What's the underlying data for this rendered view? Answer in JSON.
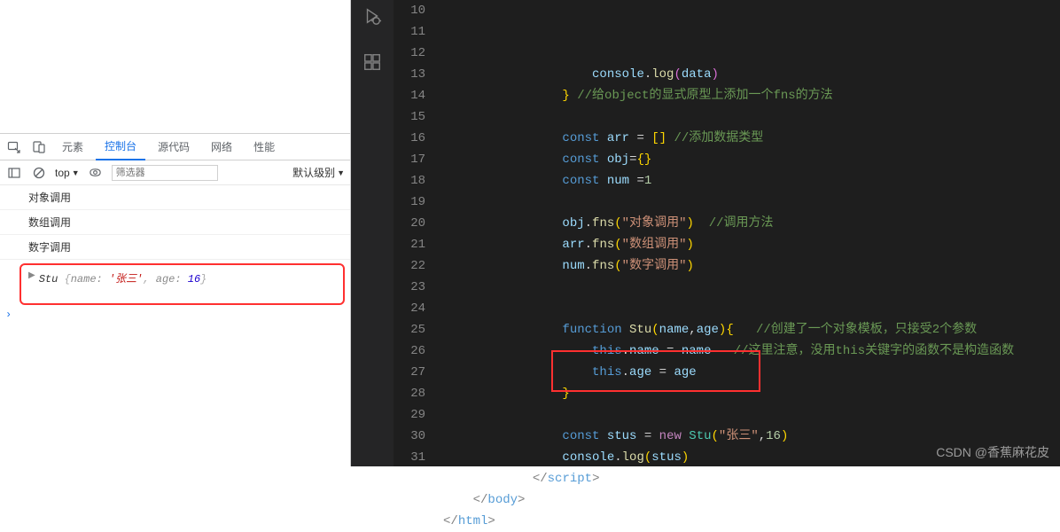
{
  "devtools": {
    "tabs": {
      "elements": "元素",
      "console": "控制台",
      "sources": "源代码",
      "network": "网络",
      "performance": "性能"
    },
    "toolbar": {
      "context": "top",
      "eye_icon": "eye-icon",
      "filter_placeholder": "筛选器",
      "level": "默认级别"
    },
    "console_logs": [
      "对象调用",
      "数组调用",
      "数字调用"
    ],
    "object_log": {
      "class": "Stu",
      "name_key": "name:",
      "name_val": "'张三'",
      "age_key": "age:",
      "age_val": "16"
    }
  },
  "editor": {
    "line_start": 10,
    "line_end": 31,
    "lines": {
      "10": [
        {
          "t": "                    ",
          "c": ""
        },
        {
          "t": "console",
          "c": "var"
        },
        {
          "t": ".",
          "c": "op"
        },
        {
          "t": "log",
          "c": "fn"
        },
        {
          "t": "(",
          "c": "brk2"
        },
        {
          "t": "data",
          "c": "var"
        },
        {
          "t": ")",
          "c": "brk2"
        }
      ],
      "11": [
        {
          "t": "                ",
          "c": ""
        },
        {
          "t": "}",
          "c": "brk"
        },
        {
          "t": " ",
          "c": ""
        },
        {
          "t": "//给object的显式原型上添加一个fns的方法",
          "c": "cmt"
        }
      ],
      "12": [],
      "13": [
        {
          "t": "                ",
          "c": ""
        },
        {
          "t": "const",
          "c": "kw"
        },
        {
          "t": " ",
          "c": ""
        },
        {
          "t": "arr",
          "c": "var"
        },
        {
          "t": " = ",
          "c": "op"
        },
        {
          "t": "[]",
          "c": "brk"
        },
        {
          "t": " ",
          "c": ""
        },
        {
          "t": "//添加数据类型",
          "c": "cmt"
        }
      ],
      "14": [
        {
          "t": "                ",
          "c": ""
        },
        {
          "t": "const",
          "c": "kw"
        },
        {
          "t": " ",
          "c": ""
        },
        {
          "t": "obj",
          "c": "var"
        },
        {
          "t": "=",
          "c": "op"
        },
        {
          "t": "{}",
          "c": "brk"
        }
      ],
      "15": [
        {
          "t": "                ",
          "c": ""
        },
        {
          "t": "const",
          "c": "kw"
        },
        {
          "t": " ",
          "c": ""
        },
        {
          "t": "num",
          "c": "var"
        },
        {
          "t": " =",
          "c": "op"
        },
        {
          "t": "1",
          "c": "num"
        }
      ],
      "16": [],
      "17": [
        {
          "t": "                ",
          "c": ""
        },
        {
          "t": "obj",
          "c": "var"
        },
        {
          "t": ".",
          "c": "op"
        },
        {
          "t": "fns",
          "c": "fn"
        },
        {
          "t": "(",
          "c": "brk"
        },
        {
          "t": "\"对象调用\"",
          "c": "str"
        },
        {
          "t": ")",
          "c": "brk"
        },
        {
          "t": "  ",
          "c": ""
        },
        {
          "t": "//调用方法",
          "c": "cmt"
        }
      ],
      "18": [
        {
          "t": "                ",
          "c": ""
        },
        {
          "t": "arr",
          "c": "var"
        },
        {
          "t": ".",
          "c": "op"
        },
        {
          "t": "fns",
          "c": "fn"
        },
        {
          "t": "(",
          "c": "brk"
        },
        {
          "t": "\"数组调用\"",
          "c": "str"
        },
        {
          "t": ")",
          "c": "brk"
        }
      ],
      "19": [
        {
          "t": "                ",
          "c": ""
        },
        {
          "t": "num",
          "c": "var"
        },
        {
          "t": ".",
          "c": "op"
        },
        {
          "t": "fns",
          "c": "fn"
        },
        {
          "t": "(",
          "c": "brk"
        },
        {
          "t": "\"数字调用\"",
          "c": "str"
        },
        {
          "t": ")",
          "c": "brk"
        }
      ],
      "20": [],
      "21": [],
      "22": [
        {
          "t": "                ",
          "c": ""
        },
        {
          "t": "function",
          "c": "kw"
        },
        {
          "t": " ",
          "c": ""
        },
        {
          "t": "Stu",
          "c": "fn"
        },
        {
          "t": "(",
          "c": "brk"
        },
        {
          "t": "name",
          "c": "var"
        },
        {
          "t": ",",
          "c": "op"
        },
        {
          "t": "age",
          "c": "var"
        },
        {
          "t": ")",
          "c": "brk"
        },
        {
          "t": "{",
          "c": "brk"
        },
        {
          "t": "   ",
          "c": ""
        },
        {
          "t": "//创建了一个对象模板，只接受2个参数",
          "c": "cmt"
        }
      ],
      "23": [
        {
          "t": "                    ",
          "c": ""
        },
        {
          "t": "this",
          "c": "kw"
        },
        {
          "t": ".",
          "c": "op"
        },
        {
          "t": "name",
          "c": "var"
        },
        {
          "t": " = ",
          "c": "op"
        },
        {
          "t": "name",
          "c": "var"
        },
        {
          "t": "   ",
          "c": ""
        },
        {
          "t": "//这里注意，没用this关键字的函数不是构造函数",
          "c": "cmt"
        }
      ],
      "24": [
        {
          "t": "                    ",
          "c": ""
        },
        {
          "t": "this",
          "c": "kw"
        },
        {
          "t": ".",
          "c": "op"
        },
        {
          "t": "age",
          "c": "var"
        },
        {
          "t": " = ",
          "c": "op"
        },
        {
          "t": "age",
          "c": "var"
        }
      ],
      "25": [
        {
          "t": "                ",
          "c": ""
        },
        {
          "t": "}",
          "c": "brk"
        }
      ],
      "26": [],
      "27": [
        {
          "t": "                ",
          "c": ""
        },
        {
          "t": "const",
          "c": "kw"
        },
        {
          "t": " ",
          "c": ""
        },
        {
          "t": "stus",
          "c": "var"
        },
        {
          "t": " = ",
          "c": "op"
        },
        {
          "t": "new",
          "c": "kw2"
        },
        {
          "t": " ",
          "c": ""
        },
        {
          "t": "Stu",
          "c": "cls"
        },
        {
          "t": "(",
          "c": "brk"
        },
        {
          "t": "\"张三\"",
          "c": "str"
        },
        {
          "t": ",",
          "c": "op"
        },
        {
          "t": "16",
          "c": "num"
        },
        {
          "t": ")",
          "c": "brk"
        }
      ],
      "28": [
        {
          "t": "                ",
          "c": ""
        },
        {
          "t": "console",
          "c": "var"
        },
        {
          "t": ".",
          "c": "op"
        },
        {
          "t": "log",
          "c": "fn"
        },
        {
          "t": "(",
          "c": "brk"
        },
        {
          "t": "stus",
          "c": "var"
        },
        {
          "t": ")",
          "c": "brk"
        }
      ],
      "29": [
        {
          "t": "            ",
          "c": ""
        },
        {
          "t": "</",
          "c": "tag"
        },
        {
          "t": "script",
          "c": "tagn"
        },
        {
          "t": ">",
          "c": "tag"
        }
      ],
      "30": [
        {
          "t": "    ",
          "c": ""
        },
        {
          "t": "</",
          "c": "tag"
        },
        {
          "t": "body",
          "c": "tagn"
        },
        {
          "t": ">",
          "c": "tag"
        }
      ],
      "31": [
        {
          "t": "</",
          "c": "tag"
        },
        {
          "t": "html",
          "c": "tagn"
        },
        {
          "t": ">",
          "c": "tag"
        }
      ]
    }
  },
  "watermark": "CSDN @香蕉麻花皮"
}
